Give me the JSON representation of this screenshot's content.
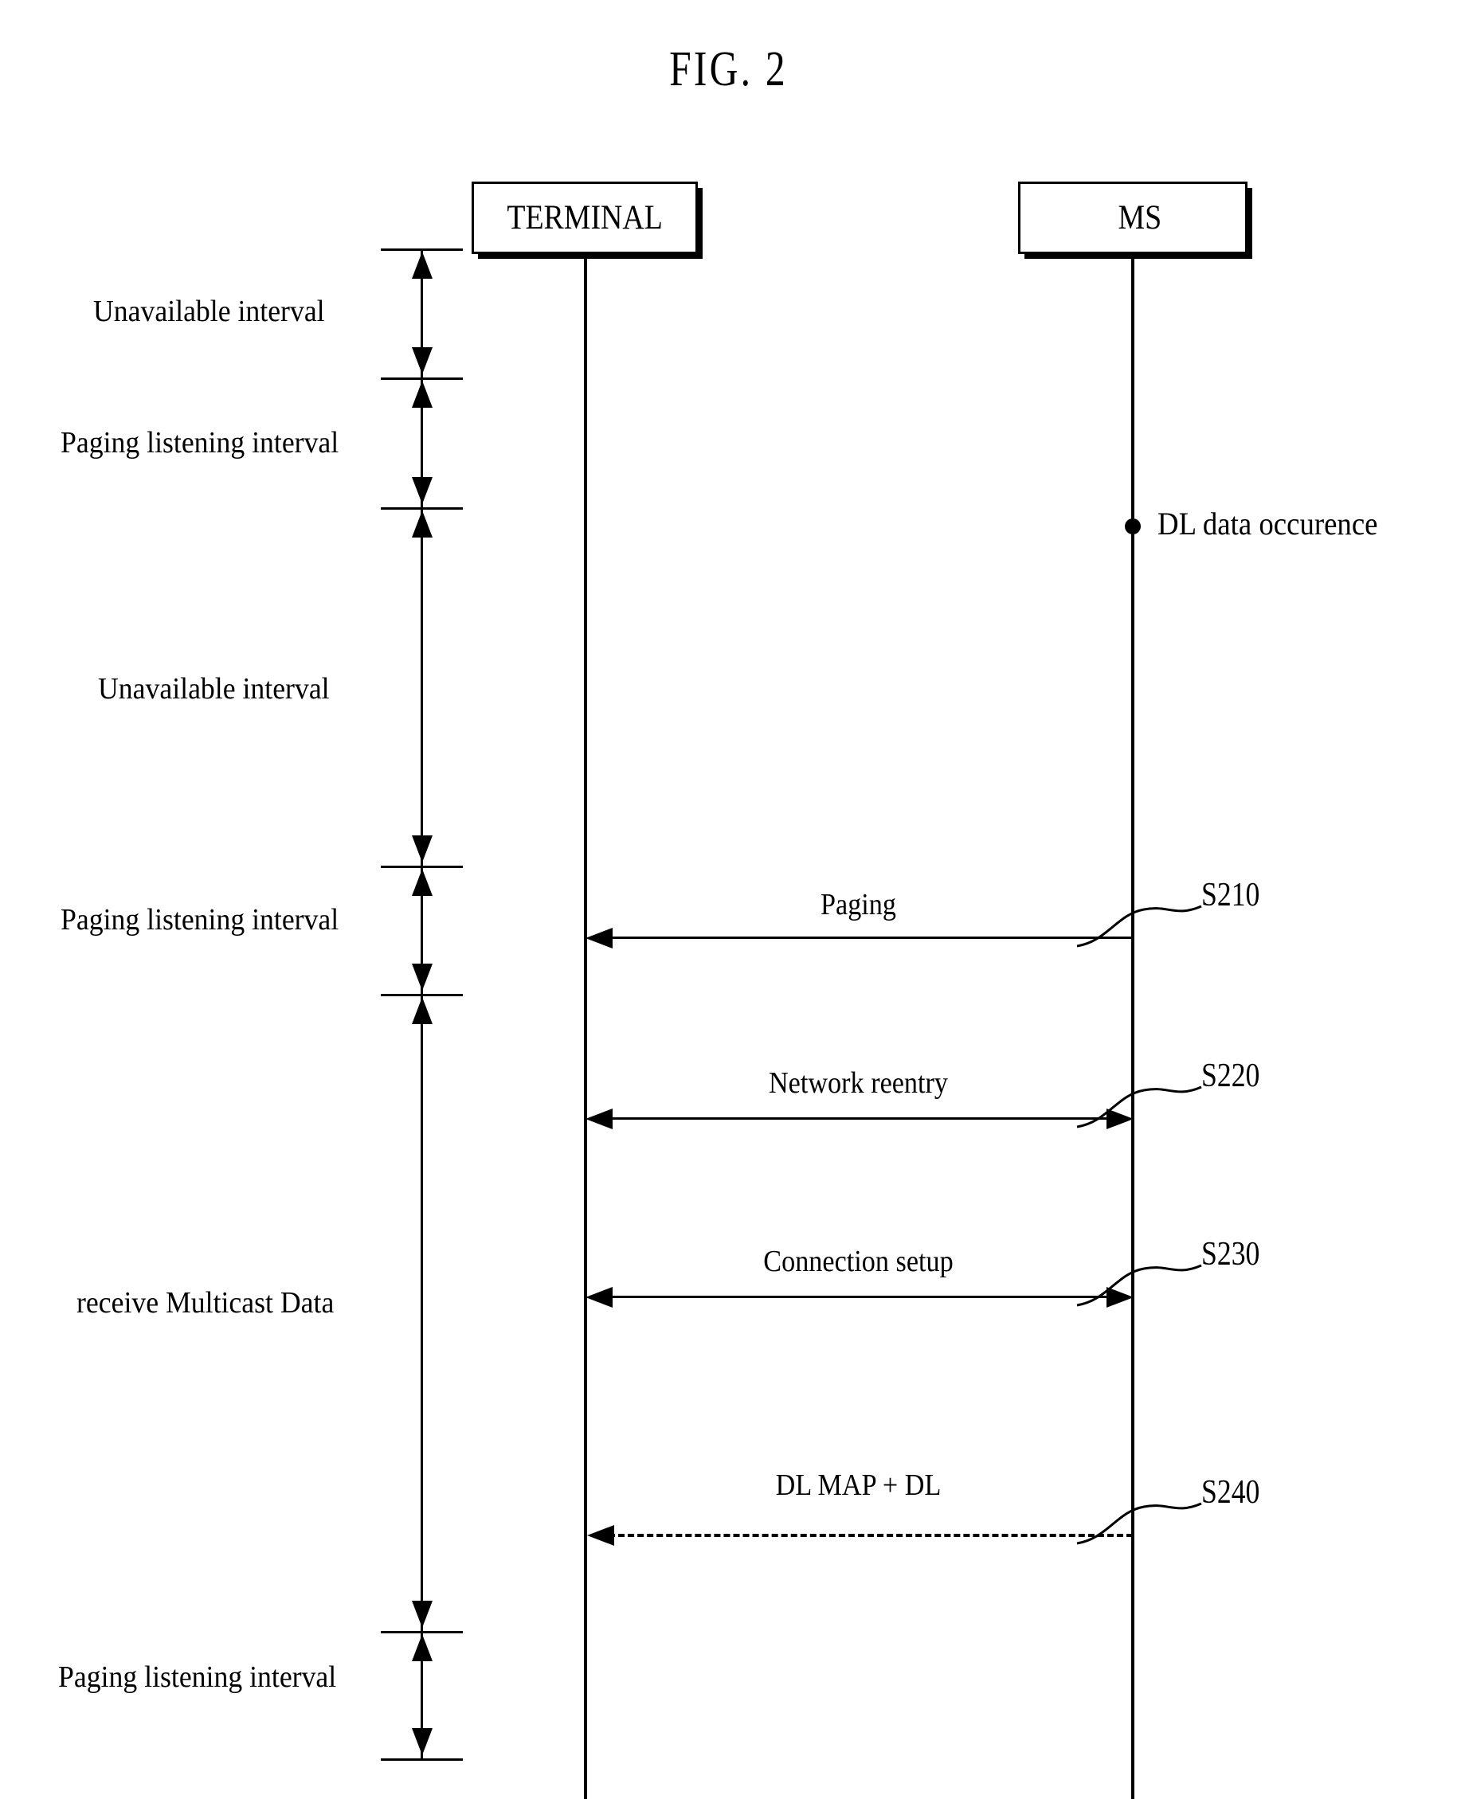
{
  "figure": {
    "title": "FIG. 2",
    "type": "sequence-diagram"
  },
  "actors": [
    {
      "id": "terminal",
      "label": "TERMINAL"
    },
    {
      "id": "ms",
      "label": "MS"
    }
  ],
  "timeline_intervals": [
    {
      "index": 0,
      "label": "Unavailable interval"
    },
    {
      "index": 1,
      "label": "Paging listening interval"
    },
    {
      "index": 2,
      "label": "Unavailable interval"
    },
    {
      "index": 3,
      "label": "Paging listening interval"
    },
    {
      "index": 4,
      "label": "receive Multicast Data"
    },
    {
      "index": 5,
      "label": "Paging listening interval"
    }
  ],
  "events": [
    {
      "id": "dl-data",
      "label": "DL data occurence",
      "actor": "ms",
      "marker": "dot"
    }
  ],
  "messages": [
    {
      "id": "s210",
      "label": "Paging",
      "step": "S210",
      "direction": "ms-to-terminal",
      "style": "solid",
      "heads": "single-left"
    },
    {
      "id": "s220",
      "label": "Network reentry",
      "step": "S220",
      "direction": "bidirectional",
      "style": "solid",
      "heads": "double"
    },
    {
      "id": "s230",
      "label": "Connection setup",
      "step": "S230",
      "direction": "bidirectional",
      "style": "solid",
      "heads": "double"
    },
    {
      "id": "s240",
      "label": "DL MAP + DL",
      "step": "S240",
      "direction": "ms-to-terminal",
      "style": "dashed",
      "heads": "single-left"
    }
  ],
  "colors": {
    "line": "#000000",
    "background": "#ffffff",
    "text": "#000000"
  }
}
